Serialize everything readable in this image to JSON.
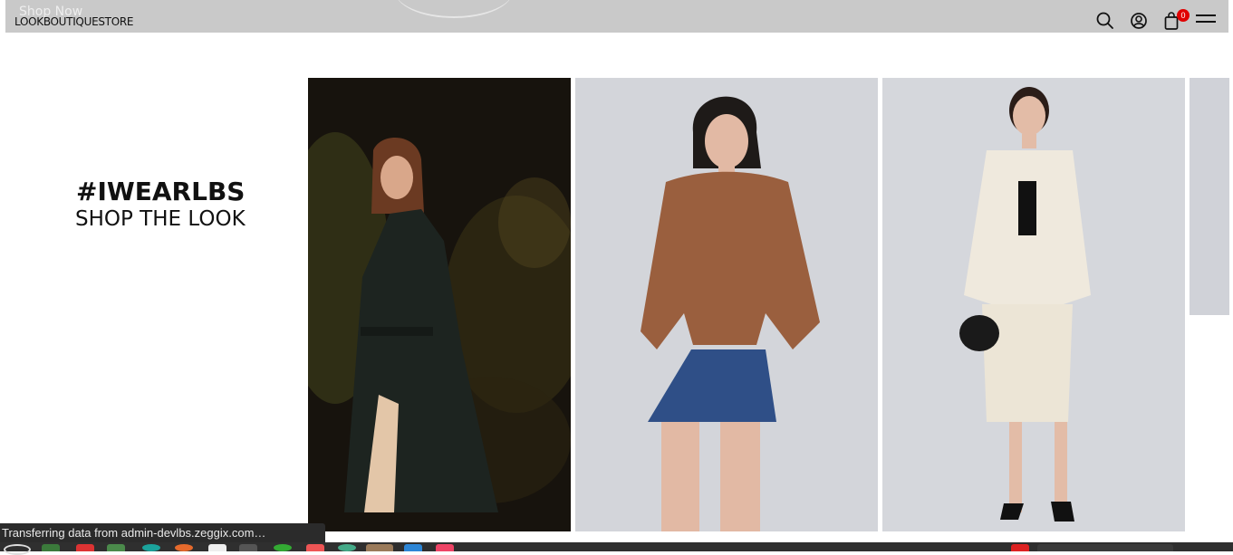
{
  "header": {
    "shop_now": "Shop Now",
    "logo": "LOOKBOUTIQUESTORE",
    "cart_count": "0",
    "icons": [
      "search-icon",
      "account-icon",
      "cart-icon",
      "menu-icon"
    ]
  },
  "section": {
    "hashtag": "#IWEARLBS",
    "subtitle": "SHOP THE LOOK"
  },
  "status_bar": {
    "text": "Transferring data from admin-devlbs.zeggix.com…"
  },
  "colors": {
    "header_bg": "#c9c9c9",
    "badge": "#e00000",
    "taskbar": "#2f2f2f"
  }
}
